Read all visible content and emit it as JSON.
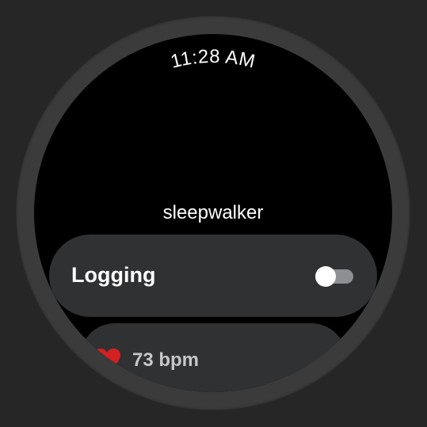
{
  "status_bar": {
    "time": "11:28 AM"
  },
  "app": {
    "title": "sleepwalker"
  },
  "logging_chip": {
    "label": "Logging",
    "toggle_on": false
  },
  "heart_rate_chip": {
    "icon": "heart-icon",
    "value": "73 bpm"
  },
  "colors": {
    "background": "#262626",
    "bezel": "#3b3b3b",
    "screen": "#000000",
    "chip": "#303133",
    "heart": "#d42020"
  }
}
